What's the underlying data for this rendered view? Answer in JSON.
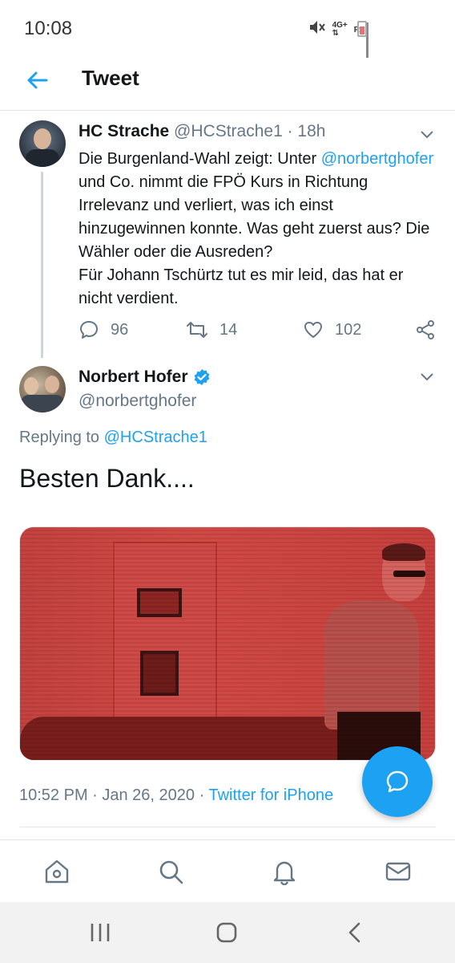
{
  "status_bar": {
    "time": "10:08",
    "network": "4G+",
    "network_sub": "R"
  },
  "header": {
    "title": "Tweet"
  },
  "tweet1": {
    "name": "HC Strache",
    "handle": "@HCStrache1",
    "separator": " · ",
    "age": "18h",
    "text_before_mention": "Die Burgenland-Wahl zeigt: Unter ",
    "mention": "@norbertghofer",
    "text_after_mention": " und Co. nimmt die FPÖ Kurs in Richtung Irrelevanz und verliert, was ich einst hinzugewinnen konnte. Was geht zuerst aus? Die Wähler oder die Ausreden?",
    "text_line2": "Für Johann Tschürtz tut es mir leid, das hat er nicht verdient.",
    "replies": "96",
    "retweets": "14",
    "likes": "102"
  },
  "tweet2": {
    "name": "Norbert Hofer",
    "handle": "@norbertghofer",
    "verified": true,
    "replying_prefix": "Replying to ",
    "replying_to": "@HCStrache1",
    "text": "Besten Dank....",
    "timestamp": "10:52 PM · Jan 26, 2020 · ",
    "source": "Twitter for iPhone"
  },
  "colors": {
    "accent": "#1da1f2",
    "text": "#14171a",
    "secondary": "#657786",
    "media_tint": "#c83c3a"
  },
  "icons": {
    "back": "arrow-left-icon",
    "more": "chevron-down-icon",
    "reply": "reply-icon",
    "retweet": "retweet-icon",
    "like": "heart-icon",
    "share": "share-icon",
    "compose": "compose-reply-icon",
    "home": "home-icon",
    "search": "search-icon",
    "notifications": "bell-icon",
    "messages": "mail-icon",
    "recent_apps": "recent-apps-icon",
    "system_home": "system-home-icon",
    "system_back": "system-back-icon"
  }
}
